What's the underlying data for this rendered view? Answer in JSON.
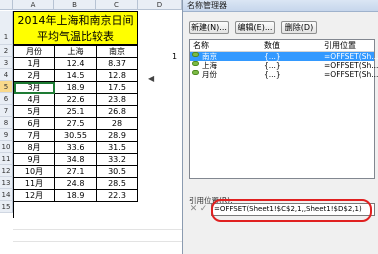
{
  "sheet": {
    "columns": [
      "A",
      "B",
      "C",
      "D"
    ],
    "rows": [
      "1",
      "2",
      "3",
      "4",
      "5",
      "6",
      "7",
      "8",
      "9",
      "10",
      "11",
      "12",
      "13",
      "14",
      "15"
    ],
    "title_line1": "2014年上海和南京日间",
    "title_line2": "平均气温比较表",
    "headers": [
      "月份",
      "上海",
      "南京"
    ],
    "data": [
      [
        "1月",
        "12.4",
        "8.37"
      ],
      [
        "2月",
        "14.5",
        "12.8"
      ],
      [
        "3月",
        "18.9",
        "17.5"
      ],
      [
        "4月",
        "22.6",
        "23.8"
      ],
      [
        "5月",
        "25.1",
        "26.8"
      ],
      [
        "6月",
        "27.5",
        "28"
      ],
      [
        "7月",
        "30.55",
        "28.9"
      ],
      [
        "8月",
        "33.6",
        "31.5"
      ],
      [
        "9月",
        "34.8",
        "33.2"
      ],
      [
        "10月",
        "27.1",
        "30.5"
      ],
      [
        "11月",
        "24.8",
        "28.5"
      ],
      [
        "12月",
        "18.9",
        "22.3"
      ]
    ],
    "side_number": "1"
  },
  "dialog": {
    "title": "名称管理器",
    "buttons": {
      "new": "新建(N)...",
      "edit": "编辑(E)...",
      "delete": "删除(D)"
    },
    "columns": {
      "name": "名称",
      "value": "数值",
      "refers_to": "引用位置"
    },
    "names": [
      {
        "name": "南京",
        "value": "{...}",
        "refers_to": "=OFFSET(Sh..."
      },
      {
        "name": "上海",
        "value": "{...}",
        "refers_to": "=OFFSET(Sh..."
      },
      {
        "name": "月份",
        "value": "{...}",
        "refers_to": "=OFFSET(Sh..."
      }
    ],
    "refers_label": "引用位置(R):",
    "refers_value": "=OFFSET(Sheet1!$C$2,1,,Sheet1!$D$2,1)",
    "highlight_color": "#e02020",
    "selection_color": "#3399ff"
  }
}
